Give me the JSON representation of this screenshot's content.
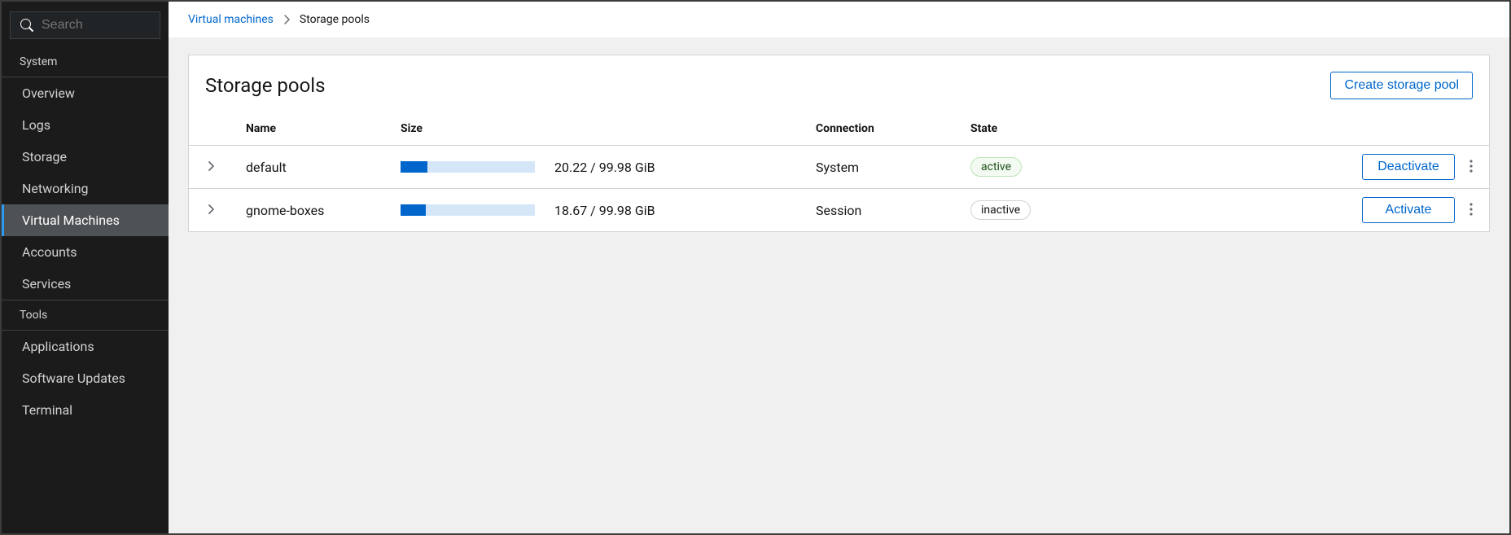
{
  "sidebar": {
    "search_placeholder": "Search",
    "sections": [
      {
        "title": "System",
        "items": [
          {
            "label": "Overview",
            "active": false
          },
          {
            "label": "Logs",
            "active": false
          },
          {
            "label": "Storage",
            "active": false
          },
          {
            "label": "Networking",
            "active": false
          },
          {
            "label": "Virtual Machines",
            "active": true
          },
          {
            "label": "Accounts",
            "active": false
          },
          {
            "label": "Services",
            "active": false
          }
        ]
      },
      {
        "title": "Tools",
        "items": [
          {
            "label": "Applications",
            "active": false
          },
          {
            "label": "Software Updates",
            "active": false
          },
          {
            "label": "Terminal",
            "active": false
          }
        ]
      }
    ]
  },
  "breadcrumb": {
    "parent": "Virtual machines",
    "current": "Storage pools"
  },
  "page": {
    "title": "Storage pools",
    "create_button": "Create storage pool"
  },
  "table": {
    "columns": {
      "name": "Name",
      "size": "Size",
      "connection": "Connection",
      "state": "State"
    },
    "rows": [
      {
        "name": "default",
        "used": 20.22,
        "total": 99.98,
        "unit": "GiB",
        "size_text": "20.22 / 99.98 GiB",
        "percent": 20.22,
        "connection": "System",
        "state": "active",
        "state_class": "active",
        "action_label": "Deactivate"
      },
      {
        "name": "gnome-boxes",
        "used": 18.67,
        "total": 99.98,
        "unit": "GiB",
        "size_text": "18.67 / 99.98 GiB",
        "percent": 18.67,
        "connection": "Session",
        "state": "inactive",
        "state_class": "inactive",
        "action_label": "Activate"
      }
    ]
  }
}
